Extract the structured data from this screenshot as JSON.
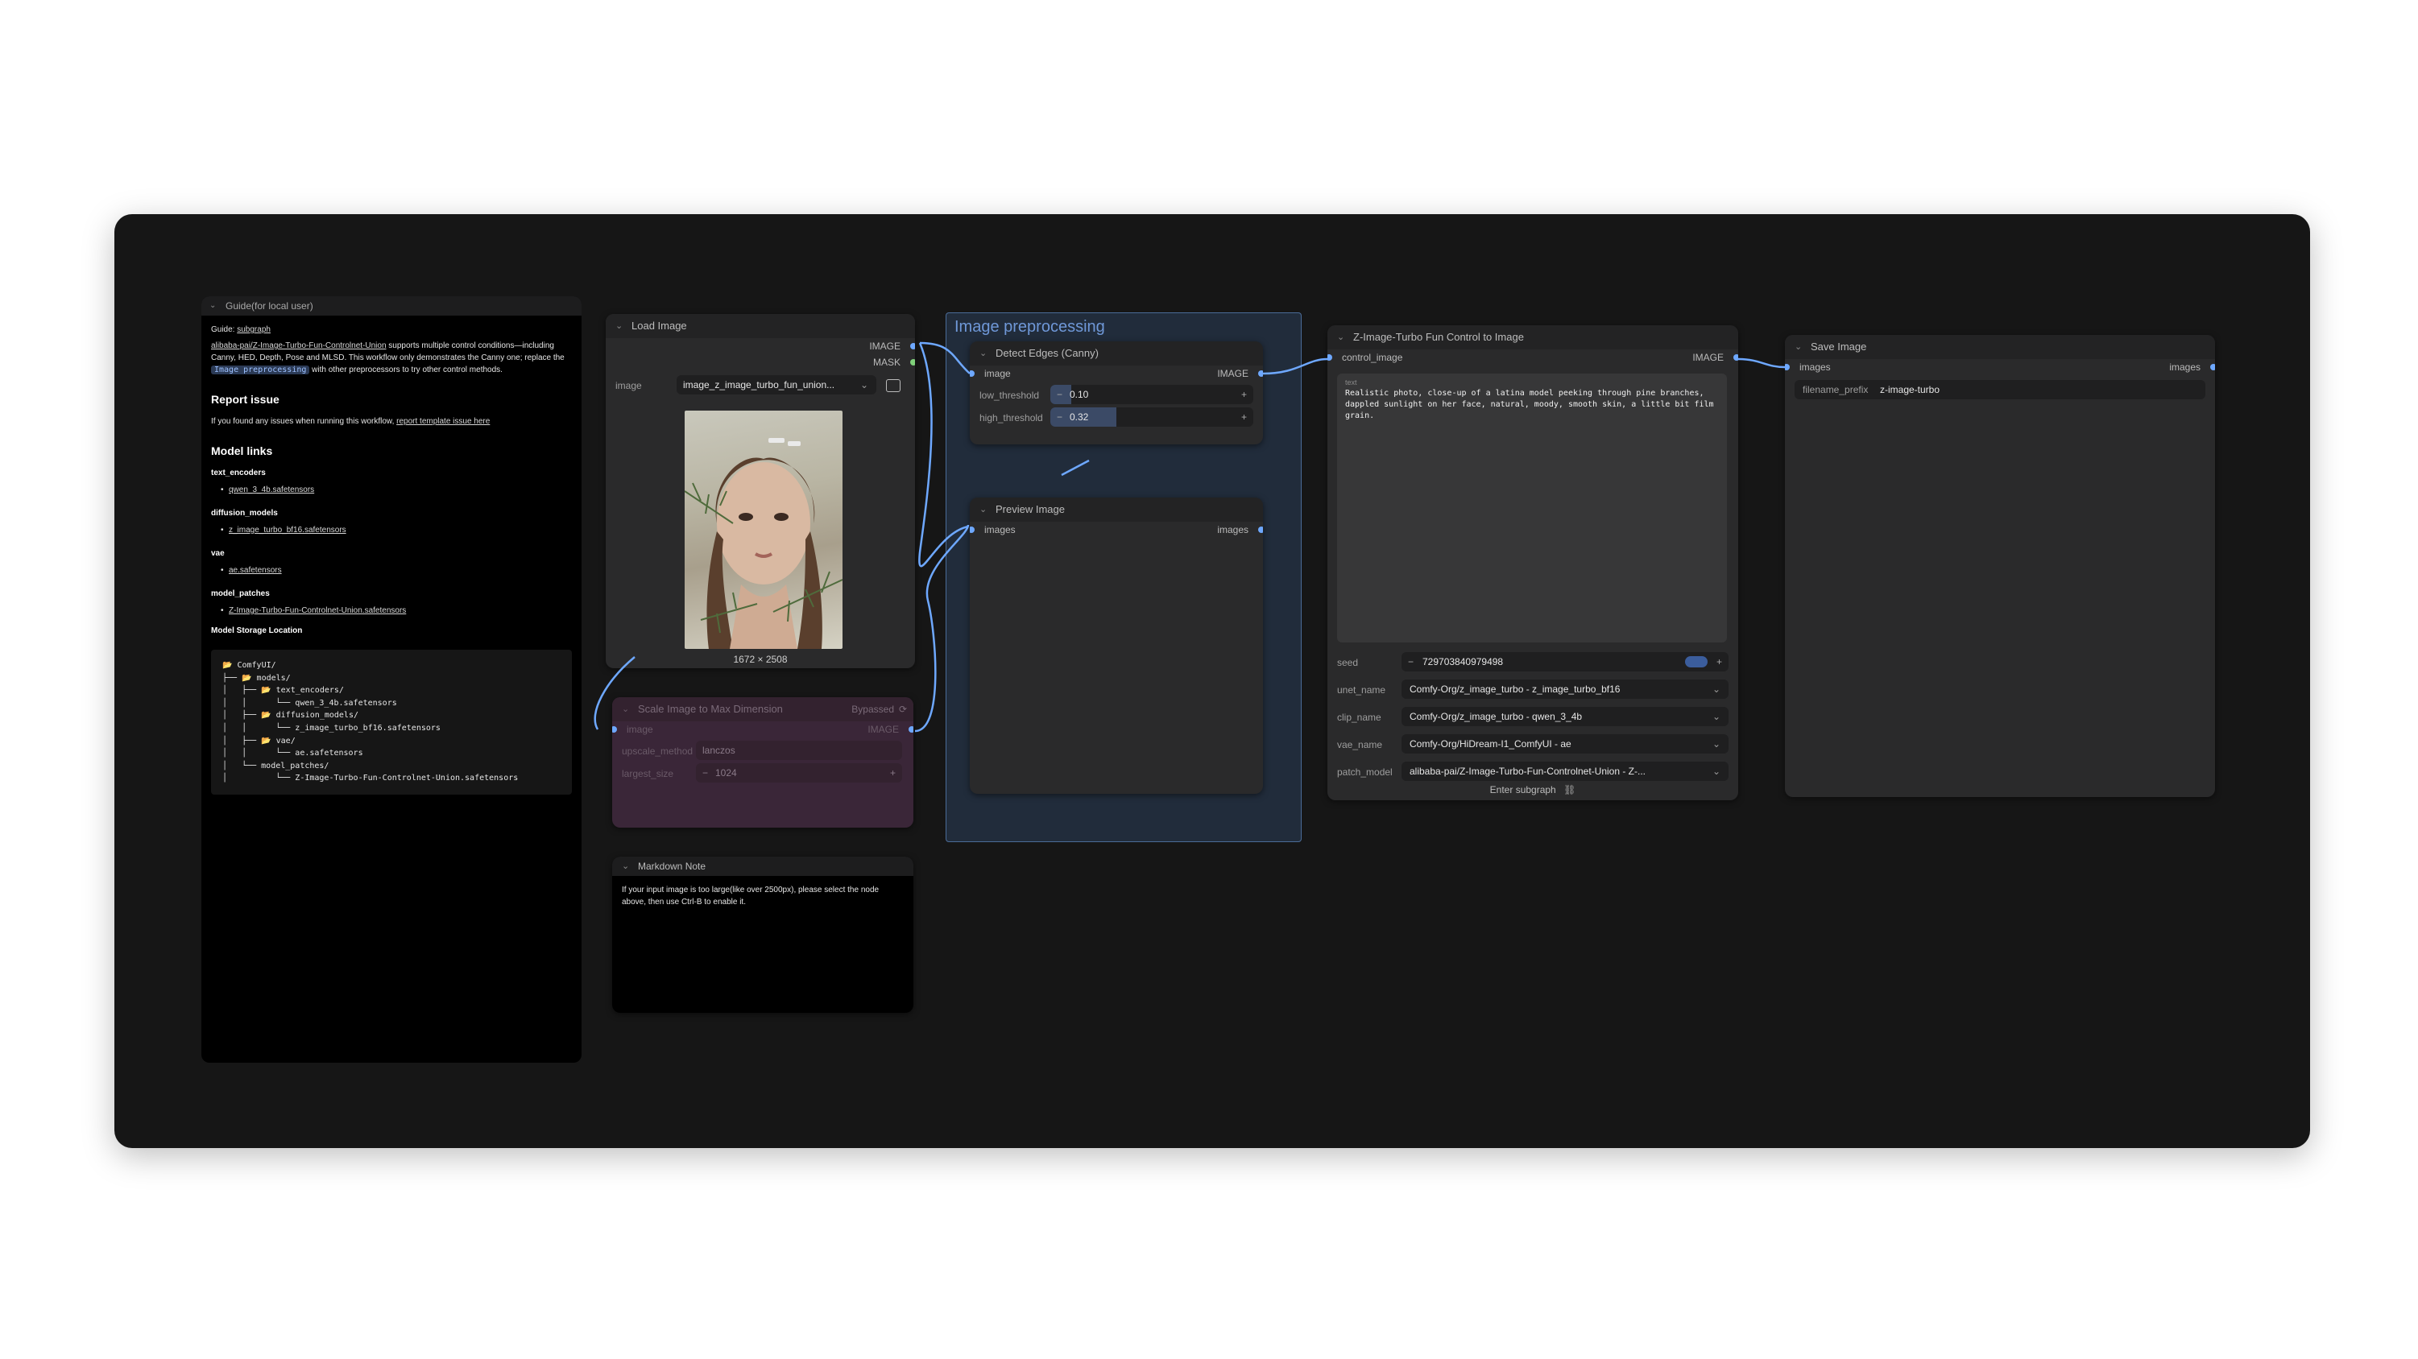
{
  "guide": {
    "title": "Guide(for local user)",
    "guide_label": "Guide:",
    "guide_link": "subgraph",
    "intro_link": "alibaba-pai/Z-Image-Turbo-Fun-Controlnet-Union",
    "intro_text": "supports multiple control conditions—including Canny, HED, Depth, Pose and MLSD. This workflow only demonstrates the Canny one; replace the",
    "intro_tag": "Image preprocessing",
    "intro_text2": "with other preprocessors to try other control methods.",
    "report_heading": "Report issue",
    "report_text": "If you found any issues when running this workflow,",
    "report_link": "report template issue here",
    "models_heading": "Model links",
    "sections": [
      {
        "name": "text_encoders",
        "file": "qwen_3_4b.safetensors"
      },
      {
        "name": "diffusion_models",
        "file": "z_image_turbo_bf16.safetensors"
      },
      {
        "name": "vae",
        "file": "ae.safetensors"
      },
      {
        "name": "model_patches",
        "file": "Z-Image-Turbo-Fun-Controlnet-Union.safetensors"
      }
    ],
    "storage_heading": "Model Storage Location",
    "tree": "📂 ComfyUI/\n├── 📂 models/\n│   ├── 📂 text_encoders/\n│   │      └── qwen_3_4b.safetensors\n│   ├── 📂 diffusion_models/\n│   │      └── z_image_turbo_bf16.safetensors\n│   ├── 📂 vae/\n│   │      └── ae.safetensors\n│   └── model_patches/\n│          └── Z-Image-Turbo-Fun-Controlnet-Union.safetensors"
  },
  "load_image": {
    "title": "Load Image",
    "out_image": "IMAGE",
    "out_mask": "MASK",
    "image_label": "image",
    "image_value": "image_z_image_turbo_fun_union...",
    "dimensions": "1672 × 2508"
  },
  "scale": {
    "title": "Scale Image to Max Dimension",
    "status": "Bypassed",
    "in_image": "image",
    "out_image": "IMAGE",
    "upscale_label": "upscale_method",
    "upscale_value": "lanczos",
    "largest_label": "largest_size",
    "largest_value": "1024"
  },
  "markdown": {
    "title": "Markdown Note",
    "text": "If your input image is too large(like over 2500px), please select the node above, then use Ctrl-B to enable it."
  },
  "group": {
    "title": "Image preprocessing"
  },
  "canny": {
    "title": "Detect Edges (Canny)",
    "in_image": "image",
    "out_image": "IMAGE",
    "low_label": "low_threshold",
    "low_value": "0.10",
    "high_label": "high_threshold",
    "high_value": "0.32"
  },
  "preview": {
    "title": "Preview Image",
    "in_images": "images",
    "out_images": "images"
  },
  "control": {
    "title": "Z-Image-Turbo Fun Control to Image",
    "in_control": "control_image",
    "out_image": "IMAGE",
    "text_label": "text",
    "text_value": "Realistic photo, close-up of a latina model peeking through pine branches, dappled sunlight on her face, natural, moody, smooth skin, a little bit film grain.",
    "seed_label": "seed",
    "seed_value": "729703840979498",
    "unet_label": "unet_name",
    "unet_value": "Comfy-Org/z_image_turbo - z_image_turbo_bf16",
    "clip_label": "clip_name",
    "clip_value": "Comfy-Org/z_image_turbo - qwen_3_4b",
    "vae_label": "vae_name",
    "vae_value": "Comfy-Org/HiDream-I1_ComfyUI - ae",
    "patch_label": "patch_model",
    "patch_value": "alibaba-pai/Z-Image-Turbo-Fun-Controlnet-Union - Z-...",
    "enter_subgraph": "Enter subgraph"
  },
  "save": {
    "title": "Save Image",
    "in_images": "images",
    "out_images": "images",
    "prefix_label": "filename_prefix",
    "prefix_value": "z-image-turbo"
  },
  "colors": {
    "canvas": "#161616",
    "node": "#2a2a2b",
    "wire": "#6ea8ff",
    "bypass": "#3a2638",
    "group": "#3f689e"
  }
}
